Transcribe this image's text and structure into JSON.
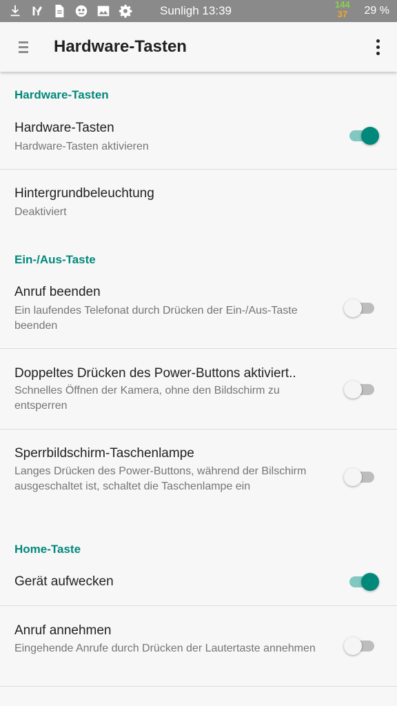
{
  "status_bar": {
    "carrier_time": "Sunligh 13:39",
    "speed_up": "144",
    "speed_down": "37",
    "battery": "29 %",
    "icons": [
      "download-icon",
      "signal-app-icon",
      "file-icon",
      "robot-icon",
      "image-icon",
      "gear-icon"
    ]
  },
  "app_bar": {
    "title": "Hardware-Tasten",
    "menu_icon": "hamburger-menu-icon",
    "overflow_icon": "more-vert-icon"
  },
  "sections": {
    "hardware": {
      "header": "Hardware-Tasten"
    },
    "power": {
      "header": "Ein-/Aus-Taste"
    },
    "home": {
      "header": "Home-Taste"
    }
  },
  "prefs": {
    "hardware_keys": {
      "title": "Hardware-Tasten",
      "summary": "Hardware-Tasten aktivieren",
      "checked": true
    },
    "backlight": {
      "title": "Hintergrundbeleuchtung",
      "summary": "Deaktiviert"
    },
    "end_call": {
      "title": "Anruf beenden",
      "summary": "Ein laufendes Telefonat durch Drücken der Ein-/Aus-Taste beenden",
      "checked": false
    },
    "double_press": {
      "title": "Doppeltes Drücken des Power-Buttons aktiviert..",
      "summary": "Schnelles Öffnen der Kamera, ohne den Bildschirm zu entsperren",
      "checked": false
    },
    "torch": {
      "title": "Sperrbildschirm-Taschenlampe",
      "summary": "Langes Drücken des Power-Buttons, während der Bilschirm ausgeschaltet ist, schaltet die Taschenlampe ein",
      "checked": false
    },
    "wake": {
      "title": "Gerät aufwecken",
      "checked": true
    },
    "answer_call": {
      "title": "Anruf annehmen",
      "summary": "Eingehende Anrufe durch Drücken der Lautertaste annehmen",
      "checked": false
    }
  },
  "colors": {
    "accent": "#00897b",
    "status_bar": "#8a8a8a",
    "speed_up": "#8bd14a",
    "speed_down": "#f5a623"
  }
}
